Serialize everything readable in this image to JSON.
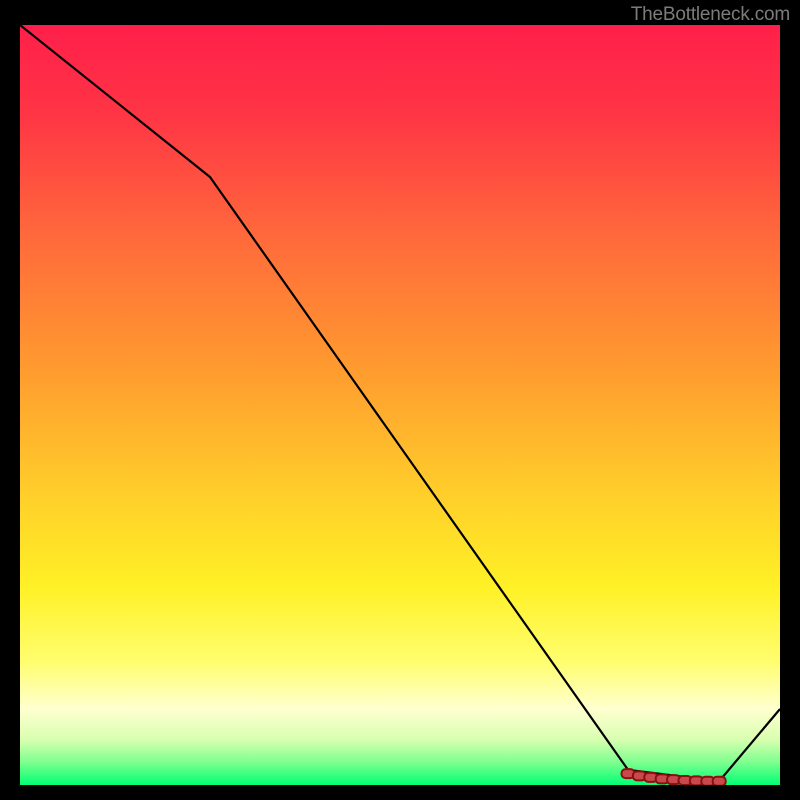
{
  "watermark": "TheBottleneck.com",
  "colors": {
    "line": "#000000",
    "marker_outline": "#8a0f10",
    "marker_fill": "#c9484b",
    "gradient": [
      {
        "offset": 0.0,
        "color": "#ff1f4a"
      },
      {
        "offset": 0.12,
        "color": "#ff3545"
      },
      {
        "offset": 0.28,
        "color": "#ff6a3b"
      },
      {
        "offset": 0.45,
        "color": "#ff9a2f"
      },
      {
        "offset": 0.62,
        "color": "#ffcf2a"
      },
      {
        "offset": 0.74,
        "color": "#fff126"
      },
      {
        "offset": 0.84,
        "color": "#fffe71"
      },
      {
        "offset": 0.9,
        "color": "#ffffd0"
      },
      {
        "offset": 0.94,
        "color": "#d9ffb0"
      },
      {
        "offset": 0.97,
        "color": "#7eff8f"
      },
      {
        "offset": 1.0,
        "color": "#00ff74"
      }
    ]
  },
  "chart_data": {
    "type": "line",
    "title": "",
    "xlabel": "",
    "ylabel": "",
    "xlim": [
      0,
      100
    ],
    "ylim": [
      0,
      100
    ],
    "x": [
      0,
      25,
      80,
      92,
      100
    ],
    "y": [
      100,
      80,
      2,
      0.5,
      10
    ],
    "markers": {
      "x": [
        80,
        81.5,
        83,
        84.5,
        86,
        87.5,
        89,
        90.5,
        92
      ],
      "y": [
        1.5,
        1.2,
        1.0,
        0.8,
        0.7,
        0.6,
        0.55,
        0.5,
        0.5
      ]
    },
    "annotations": [
      "TheBottleneck.com"
    ]
  }
}
